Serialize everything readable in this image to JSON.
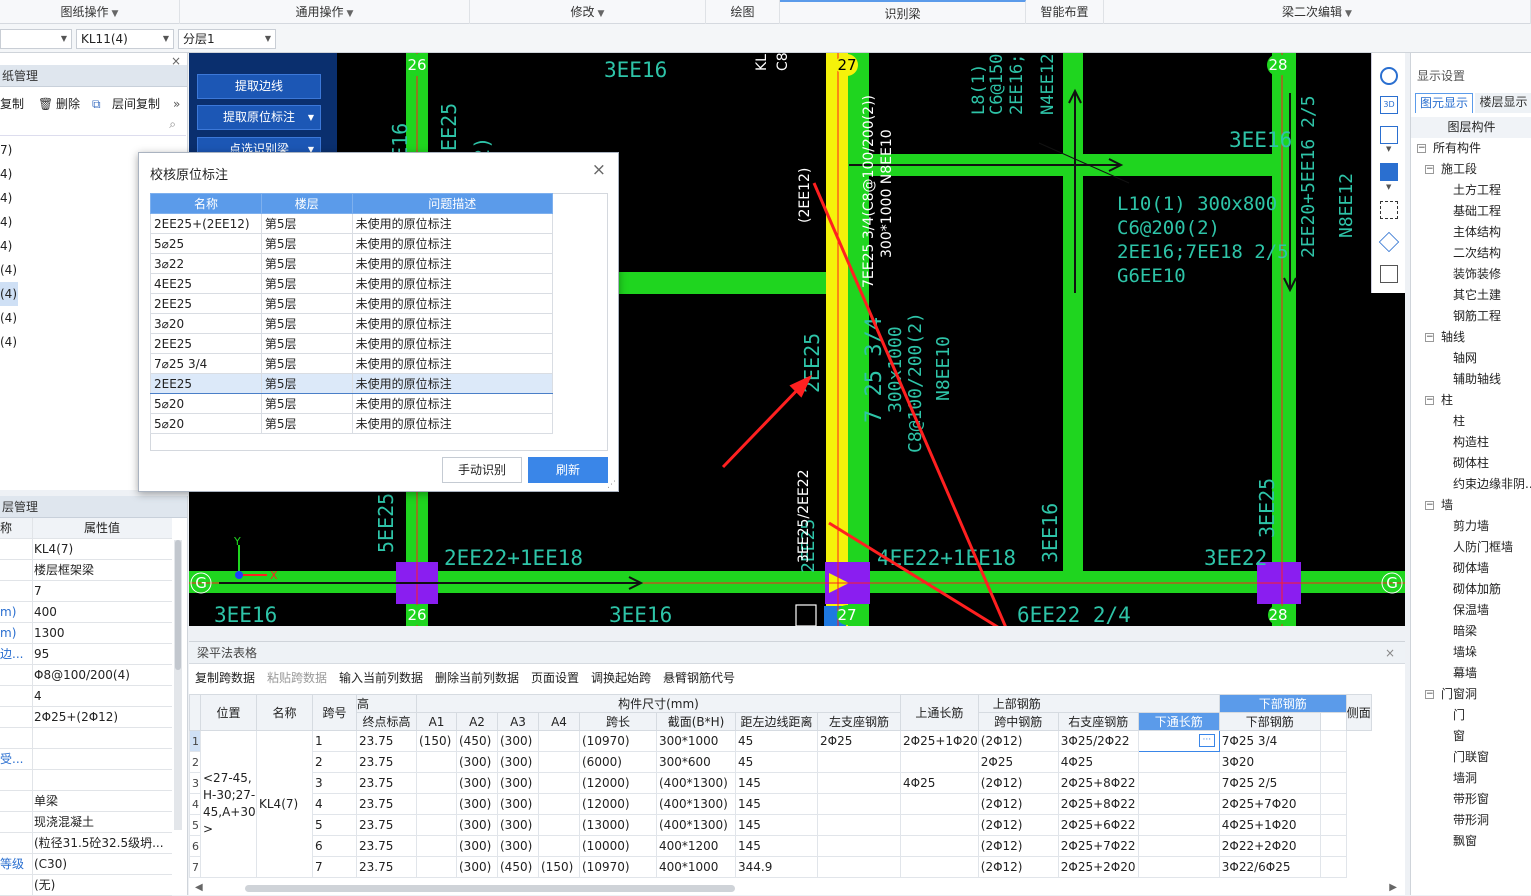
{
  "menubar": {
    "items": [
      "图纸操作",
      "通用操作",
      "修改",
      "绘图",
      "识别梁",
      "智能布置",
      "梁二次编辑"
    ]
  },
  "selectors": {
    "beam": "KL11(4)",
    "layer": "分层1"
  },
  "left_panel": {
    "drawing_title": "纸管理",
    "toolbar": {
      "copy": "复制",
      "delete": "删除",
      "floor_copy": "层间复制"
    },
    "list_items": [
      "7)",
      "4)",
      "4)",
      "4)",
      "4)",
      "(4)",
      "(4)",
      "(4)",
      "(4)"
    ],
    "props_title": "层管理",
    "props_header": {
      "name": "称",
      "value": "属性值"
    },
    "props": [
      {
        "k": "",
        "v": "KL4(7)"
      },
      {
        "k": "",
        "v": "楼层框架梁"
      },
      {
        "k": "",
        "v": "7"
      },
      {
        "k": "m)",
        "v": "400"
      },
      {
        "k": "m)",
        "v": "1300"
      },
      {
        "k": "边...",
        "v": "95"
      },
      {
        "k": "",
        "v": "Φ8@100/200(4)"
      },
      {
        "k": "",
        "v": "4"
      },
      {
        "k": "",
        "v": "2Φ25+(2Φ12)"
      },
      {
        "k": "",
        "v": ""
      },
      {
        "k": "受...",
        "v": ""
      },
      {
        "k": "",
        "v": ""
      },
      {
        "k": "",
        "v": "单梁"
      },
      {
        "k": "",
        "v": "现浇混凝土"
      },
      {
        "k": "",
        "v": "(粒径31.5砼32.5级坍..."
      },
      {
        "k": "等级",
        "v": "(C30)"
      },
      {
        "k": "",
        "v": "(无)"
      }
    ]
  },
  "side_tools": {
    "extract_edge": "提取边线",
    "extract_mark": "提取原位标注",
    "pick_identify": "点选识别梁"
  },
  "canvas": {
    "axis_labels": {
      "a26": "26",
      "a27": "27",
      "a28": "28",
      "g": "G"
    },
    "texts": {
      "t1": "3EE16",
      "t2": "3EE16",
      "t3": "L10(1) 300x800",
      "t4": "C6@200(2)",
      "t5": "2EE16;7EE18 2/5",
      "t6": "G6EE10",
      "t7": "2EE22+1EE18",
      "t8": "4EE22+1EE18",
      "t9": "3EE16",
      "t10": "3EE16",
      "t11": "6EE22 2/4",
      "t12": "3EE22",
      "t13": "3EE16",
      "t14": "2EE25",
      "t15": "5EE25",
      "v1": "(2EE12)",
      "v2": "7EE25 3/4(C8@100/200(2))",
      "v3": "300*1000 N8EE10",
      "v4": "3EE25/2EE22",
      "v5": "7 25 3/4",
      "v6": "300x1000",
      "v7": "C8@100/200(2)",
      "v8": "N8EE10",
      "v9": "2EE20+5EE16 2/5",
      "v10": "N8EE12",
      "v11": "3EE25",
      "v12": "3EE16",
      "v13": "2EE25",
      "v14": "L8(1) 25",
      "v15": "C6@150(",
      "v16": "2EE16;2",
      "v17": "N4EE12",
      "v18": "KL",
      "v19": "C8",
      "v20": "2EE25",
      "v21": "(2)",
      "v22": "10"
    }
  },
  "dialog": {
    "title": "校核原位标注",
    "headers": [
      "名称",
      "楼层",
      "问题描述"
    ],
    "rows": [
      [
        "2EE25+(2EE12)",
        "第5层",
        "未使用的原位标注"
      ],
      [
        "5⌀25",
        "第5层",
        "未使用的原位标注"
      ],
      [
        "3⌀22",
        "第5层",
        "未使用的原位标注"
      ],
      [
        "4EE25",
        "第5层",
        "未使用的原位标注"
      ],
      [
        "2EE25",
        "第5层",
        "未使用的原位标注"
      ],
      [
        "3⌀20",
        "第5层",
        "未使用的原位标注"
      ],
      [
        "2EE25",
        "第5层",
        "未使用的原位标注"
      ],
      [
        "7⌀25 3/4",
        "第5层",
        "未使用的原位标注"
      ],
      [
        "2EE25",
        "第5层",
        "未使用的原位标注"
      ],
      [
        "5⌀20",
        "第5层",
        "未使用的原位标注"
      ],
      [
        "5⌀20",
        "第5层",
        "未使用的原位标注"
      ]
    ],
    "selected_row": 8,
    "manual_button": "手动识别",
    "refresh_button": "刷新"
  },
  "view_tools": [
    "sphere-icon",
    "3d-icon",
    "cube-icon",
    "cube-blue-icon",
    "frame-icon",
    "box-icon",
    "list-icon"
  ],
  "right_panel": {
    "title": "显示设置",
    "tab_elements": "图元显示",
    "tab_layers": "楼层显示",
    "header": "图层构件",
    "tree": [
      {
        "level": 0,
        "box": "−",
        "text": "所有构件"
      },
      {
        "level": 1,
        "box": "−",
        "text": "施工段"
      },
      {
        "level": 2,
        "box": "",
        "text": "土方工程"
      },
      {
        "level": 2,
        "box": "",
        "text": "基础工程"
      },
      {
        "level": 2,
        "box": "",
        "text": "主体结构"
      },
      {
        "level": 2,
        "box": "",
        "text": "二次结构"
      },
      {
        "level": 2,
        "box": "",
        "text": "装饰装修"
      },
      {
        "level": 2,
        "box": "",
        "text": "其它土建"
      },
      {
        "level": 2,
        "box": "",
        "text": "钢筋工程"
      },
      {
        "level": 1,
        "box": "−",
        "text": "轴线"
      },
      {
        "level": 2,
        "box": "",
        "text": "轴网"
      },
      {
        "level": 2,
        "box": "",
        "text": "辅助轴线"
      },
      {
        "level": 1,
        "box": "−",
        "text": "柱"
      },
      {
        "level": 2,
        "box": "",
        "text": "柱"
      },
      {
        "level": 2,
        "box": "",
        "text": "构造柱"
      },
      {
        "level": 2,
        "box": "",
        "text": "砌体柱"
      },
      {
        "level": 2,
        "box": "",
        "text": "约束边缘非阴..."
      },
      {
        "level": 1,
        "box": "−",
        "text": "墙"
      },
      {
        "level": 2,
        "box": "",
        "text": "剪力墙"
      },
      {
        "level": 2,
        "box": "",
        "text": "人防门框墙"
      },
      {
        "level": 2,
        "box": "",
        "text": "砌体墙"
      },
      {
        "level": 2,
        "box": "",
        "text": "砌体加筋"
      },
      {
        "level": 2,
        "box": "",
        "text": "保温墙"
      },
      {
        "level": 2,
        "box": "",
        "text": "暗梁"
      },
      {
        "level": 2,
        "box": "",
        "text": "墙垛"
      },
      {
        "level": 2,
        "box": "",
        "text": "幕墙"
      },
      {
        "level": 1,
        "box": "−",
        "text": "门窗洞"
      },
      {
        "level": 2,
        "box": "",
        "text": "门"
      },
      {
        "level": 2,
        "box": "",
        "text": "窗"
      },
      {
        "level": 2,
        "box": "",
        "text": "门联窗"
      },
      {
        "level": 2,
        "box": "",
        "text": "墙洞"
      },
      {
        "level": 2,
        "box": "",
        "text": "带形窗"
      },
      {
        "level": 2,
        "box": "",
        "text": "带形洞"
      },
      {
        "level": 2,
        "box": "",
        "text": "飘窗"
      }
    ]
  },
  "bottom": {
    "title": "梁平法表格",
    "toolbar": [
      "复制跨数据",
      "粘贴跨数据",
      "输入当前列数据",
      "删除当前列数据",
      "页面设置",
      "调换起始跨",
      "悬臂钢筋代号"
    ],
    "group_headers": {
      "elev": "高",
      "dims": "构件尺寸(mm)",
      "top": "上部钢筋",
      "bottom": "下部钢筋"
    },
    "headers": [
      "位置",
      "名称",
      "跨号",
      "终点标高",
      "A1",
      "A2",
      "A3",
      "A4",
      "跨长",
      "截面(B*H)",
      "距左边线距离",
      "上通长筋",
      "左支座钢筋",
      "跨中钢筋",
      "右支座钢筋",
      "下通长筋",
      "下部钢筋",
      "侧面"
    ],
    "position": "<27-45,H-30;27-45,A+30>",
    "name": "KL4(7)",
    "rows": [
      [
        "1",
        "1",
        "23.75",
        "(150)",
        "(450)",
        "(300)",
        "",
        "(10970)",
        "300*1000",
        "45",
        "2Φ25",
        "2Φ25+1Φ20",
        "(2Φ12)",
        "3Φ25/2Φ22",
        "",
        "7Φ25 3/4"
      ],
      [
        "2",
        "2",
        "23.75",
        "",
        "(300)",
        "(300)",
        "",
        "(6000)",
        "300*600",
        "45",
        "",
        "",
        "2Φ25",
        "4Φ25",
        "",
        "3Φ20"
      ],
      [
        "3",
        "3",
        "23.75",
        "",
        "(300)",
        "(300)",
        "",
        "(12000)",
        "(400*1300)",
        "145",
        "",
        "4Φ25",
        "(2Φ12)",
        "2Φ25+8Φ22",
        "",
        "7Φ25 2/5"
      ],
      [
        "4",
        "4",
        "23.75",
        "",
        "(300)",
        "(300)",
        "",
        "(12000)",
        "(400*1300)",
        "145",
        "",
        "",
        "(2Φ12)",
        "2Φ25+8Φ22",
        "",
        "2Φ25+7Φ20"
      ],
      [
        "5",
        "5",
        "23.75",
        "",
        "(300)",
        "(300)",
        "",
        "(13000)",
        "(400*1300)",
        "145",
        "",
        "",
        "(2Φ12)",
        "2Φ25+6Φ22",
        "",
        "4Φ25+1Φ20"
      ],
      [
        "6",
        "6",
        "23.75",
        "",
        "(300)",
        "(300)",
        "",
        "(10000)",
        "400*1200",
        "145",
        "",
        "",
        "(2Φ12)",
        "2Φ25+7Φ22",
        "",
        "2Φ22+2Φ20"
      ],
      [
        "7",
        "7",
        "23.75",
        "",
        "(300)",
        "(450)",
        "(150)",
        "(10970)",
        "400*1000",
        "344.9",
        "",
        "",
        "(2Φ12)",
        "2Φ25+2Φ20",
        "",
        "3Φ22/6Φ25"
      ]
    ]
  },
  "colors": {
    "accent": "#5b9bea",
    "beam_green": "#1fd51f",
    "beam_yellow": "#f5f20a",
    "column_purple": "#8a1ef0",
    "arrow_red": "#ff2020",
    "cad_text": "#2ec4a8"
  }
}
